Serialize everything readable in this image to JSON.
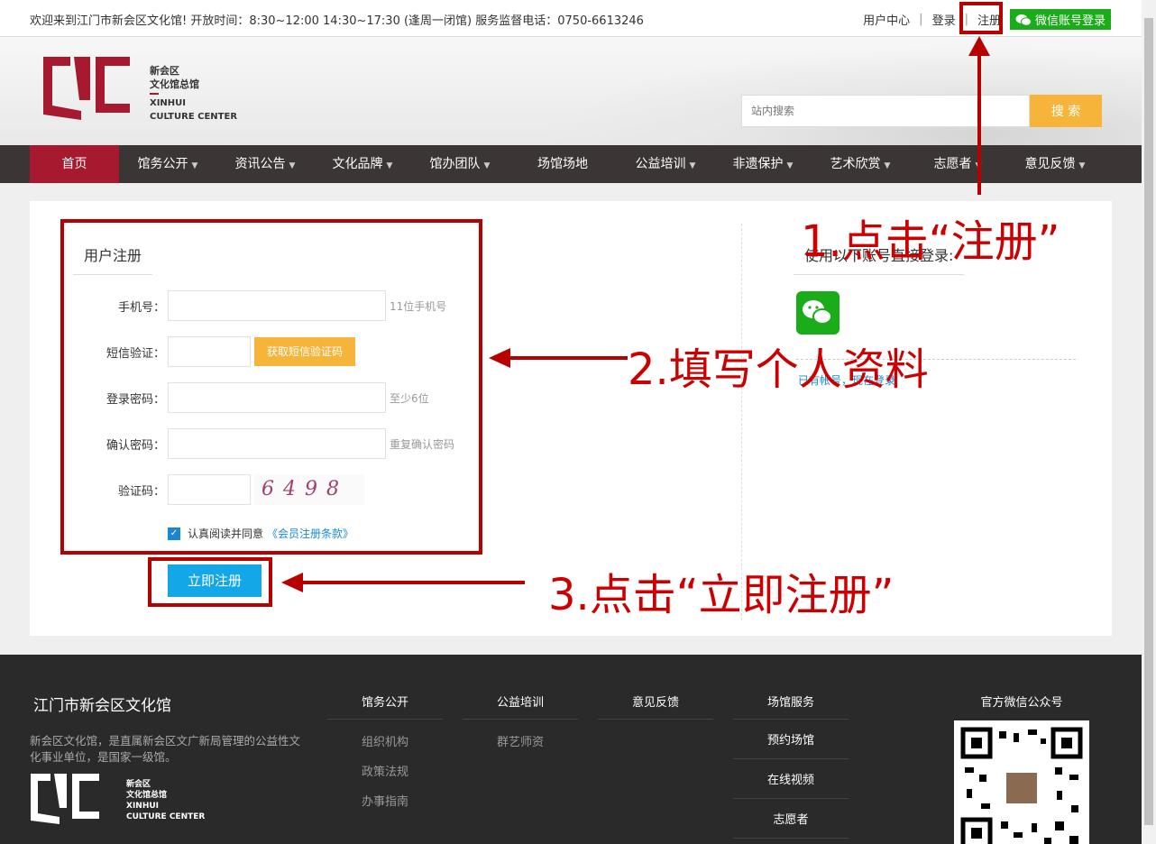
{
  "topbar": {
    "welcome": "欢迎来到江门市新会区文化馆! 开放时间：8:30~12:00 14:30~17:30 (逢周一闭馆) 服务监督电话：0750-6613246",
    "user_center": "用户中心",
    "sep": "|",
    "login": "登录",
    "register": "注册",
    "wechat_login": "微信账号登录"
  },
  "logo": {
    "line1": "新会区",
    "line2": "文化馆总馆",
    "line3": "XINHUI",
    "line4": "CULTURE CENTER"
  },
  "search": {
    "placeholder": "站内搜索",
    "button": "搜 索"
  },
  "nav": [
    {
      "label": "首页",
      "active": true
    },
    {
      "label": "馆务公开",
      "dropdown": true
    },
    {
      "label": "资讯公告",
      "dropdown": true
    },
    {
      "label": "文化品牌",
      "dropdown": true
    },
    {
      "label": "馆办团队",
      "dropdown": true
    },
    {
      "label": "场馆场地",
      "dropdown": false
    },
    {
      "label": "公益培训",
      "dropdown": true
    },
    {
      "label": "非遗保护",
      "dropdown": true
    },
    {
      "label": "艺术欣赏",
      "dropdown": true
    },
    {
      "label": "志愿者",
      "dropdown": true
    },
    {
      "label": "意见反馈",
      "dropdown": true
    }
  ],
  "form": {
    "title": "用户注册",
    "phone_label": "手机号：",
    "phone_hint": "11位手机号",
    "sms_label": "短信验证：",
    "sms_button": "获取短信验证码",
    "password_label": "登录密码：",
    "password_hint": "至少6位",
    "confirm_label": "确认密码：",
    "confirm_hint": "重复确认密码",
    "captcha_label": "验证码：",
    "captcha_text": "6498",
    "agree_text": "认真阅读并同意",
    "agree_link": "《会员注册条款》",
    "submit": "立即注册"
  },
  "alt_login": {
    "title": "使用以下账号直接登录:",
    "have_account": "已有帐号，现在登录"
  },
  "annotations": {
    "step1": "1.点击“注册”",
    "step2": "2.填写个人资料",
    "step3": "3.点击“立即注册”",
    "color": "#cc0000"
  },
  "footer": {
    "title": "江门市新会区文化馆",
    "desc": "新会区文化馆，是直属新会区文广新局管理的公益性文化事业单位，是国家一级馆。",
    "cols": [
      {
        "heading": "馆务公开",
        "items": [
          "组织机构",
          "政策法规",
          "办事指南"
        ]
      },
      {
        "heading": "公益培训",
        "items": [
          "群艺师资"
        ]
      },
      {
        "heading": "意见反馈",
        "items": []
      },
      {
        "heading": "场馆服务",
        "items": [
          "预约场馆",
          "在线视频",
          "志愿者"
        ]
      }
    ],
    "qr_title": "官方微信公众号"
  },
  "colors": {
    "brand_red": "#a6192e",
    "nav_bg": "#3b3635",
    "accent_orange": "#f6b53a",
    "submit_blue": "#13a7e8",
    "wechat_green": "#1aad19"
  }
}
